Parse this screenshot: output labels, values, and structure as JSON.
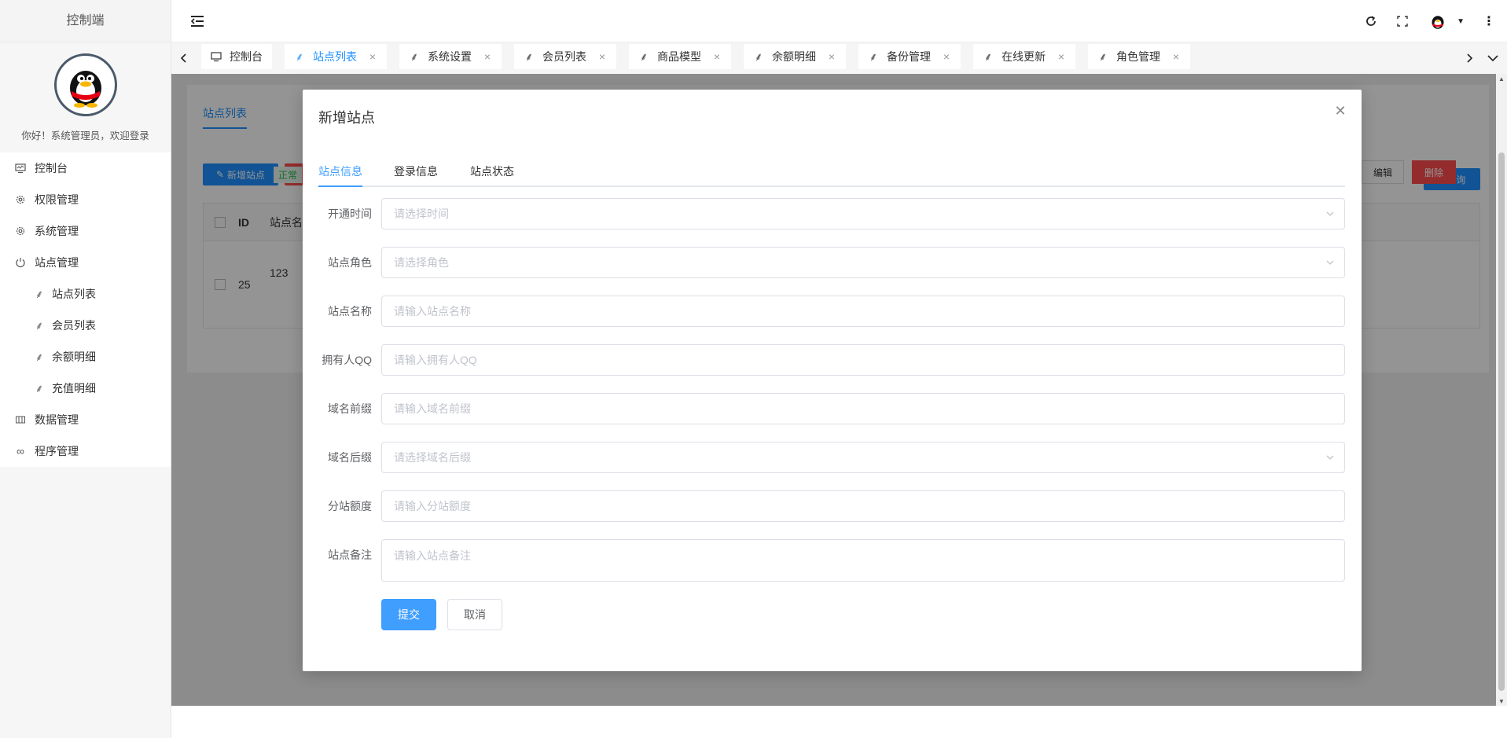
{
  "sidebar": {
    "brand": "控制端",
    "welcome": "你好！系统管理员，欢迎登录",
    "menu": [
      {
        "label": "控制台",
        "icon": "monitor-icon"
      },
      {
        "label": "权限管理",
        "icon": "gear-icon"
      },
      {
        "label": "系统管理",
        "icon": "gear-icon"
      },
      {
        "label": "站点管理",
        "icon": "power-icon"
      },
      {
        "label": "站点列表",
        "icon": "palm-icon"
      },
      {
        "label": "会员列表",
        "icon": "palm-icon"
      },
      {
        "label": "余额明细",
        "icon": "palm-icon"
      },
      {
        "label": "充值明细",
        "icon": "palm-icon"
      },
      {
        "label": "数据管理",
        "icon": "table-icon"
      },
      {
        "label": "程序管理",
        "icon": "infinity-icon"
      }
    ]
  },
  "tabs": [
    {
      "label": "控制台",
      "closable": false
    },
    {
      "label": "站点列表",
      "closable": true,
      "active": true
    },
    {
      "label": "系统设置",
      "closable": true
    },
    {
      "label": "会员列表",
      "closable": true
    },
    {
      "label": "商品模型",
      "closable": true
    },
    {
      "label": "余额明细",
      "closable": true
    },
    {
      "label": "备份管理",
      "closable": true
    },
    {
      "label": "在线更新",
      "closable": true
    },
    {
      "label": "角色管理",
      "closable": true
    }
  ],
  "background_page": {
    "title": "站点列表",
    "add_button": "新增站点",
    "query_button": "查询",
    "table_headers": [
      "ID",
      "站点名"
    ],
    "row": {
      "id": "25",
      "name": "123",
      "status": "正常",
      "edit": "编辑",
      "delete": "删除"
    }
  },
  "dialog": {
    "title": "新增站点",
    "tabs": [
      "站点信息",
      "登录信息",
      "站点状态"
    ],
    "active_tab": "站点信息",
    "fields": [
      {
        "label": "开通时间",
        "placeholder": "请选择时间",
        "type": "select"
      },
      {
        "label": "站点角色",
        "placeholder": "请选择角色",
        "type": "select"
      },
      {
        "label": "站点名称",
        "placeholder": "请输入站点名称",
        "type": "input"
      },
      {
        "label": "拥有人QQ",
        "placeholder": "请输入拥有人QQ",
        "type": "input"
      },
      {
        "label": "域名前缀",
        "placeholder": "请输入域名前缀",
        "type": "input"
      },
      {
        "label": "域名后缀",
        "placeholder": "请选择域名后缀",
        "type": "select"
      },
      {
        "label": "分站额度",
        "placeholder": "请输入分站额度",
        "type": "input"
      },
      {
        "label": "站点备注",
        "placeholder": "请输入站点备注",
        "type": "textarea"
      }
    ],
    "submit": "提交",
    "cancel": "取消"
  },
  "colors": {
    "primary": "#409eff",
    "accent": "#1e90ff",
    "danger": "#ff4d4f"
  }
}
